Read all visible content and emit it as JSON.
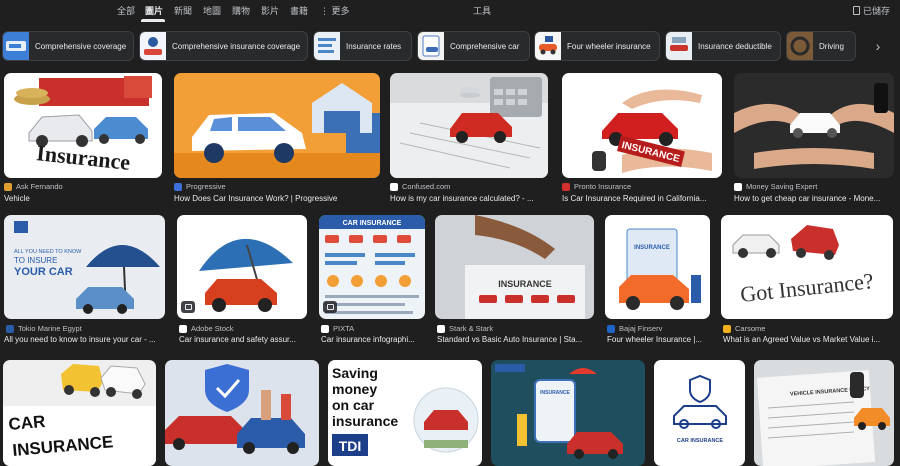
{
  "nav": {
    "tabs": [
      "全部",
      "圖片",
      "新聞",
      "地圖",
      "購物",
      "影片",
      "書籍",
      "更多",
      "工具"
    ],
    "saved": "已儲存"
  },
  "chips": [
    "Comprehensive coverage",
    "Comprehensive insurance coverage",
    "Insurance rates",
    "Comprehensive car",
    "Four wheeler insurance",
    "Insurance deductible",
    "Driving"
  ],
  "results": [
    {
      "source": "Ask Fernando",
      "title": "Vehicle",
      "image_text": "Insurance"
    },
    {
      "source": "Progressive",
      "title": "How Does Car Insurance Work? | Progressive"
    },
    {
      "source": "Confused.com",
      "title": "How is my car insurance calculated? - ..."
    },
    {
      "source": "Pronto Insurance",
      "title": "Is Car Insurance Required in California...",
      "image_text": "INSURANCE"
    },
    {
      "source": "Money Saving Expert",
      "title": "How to get cheap car insurance - Mone..."
    },
    {
      "source": "Tokio Marine Egypt",
      "title": "All you need to know to insure your car - ...",
      "image_text": [
        "ALL YOU NEED TO KNOW",
        "TO INSURE",
        "YOUR CAR"
      ]
    },
    {
      "source": "Adobe Stock",
      "title": "Car insurance and safety assur..."
    },
    {
      "source": "PIXTA",
      "title": "Car insurance infographi...",
      "image_text": "CAR INSURANCE"
    },
    {
      "source": "Stark & Stark",
      "title": "Standard vs Basic Auto Insurance | Sta...",
      "image_text": "INSURANCE"
    },
    {
      "source": "Bajaj Finserv",
      "title": "Four wheeler Insurance |...",
      "image_text": "INSURANCE"
    },
    {
      "source": "Carsome",
      "title": "What is an Agreed Value vs Market Value i...",
      "image_text": "Got Insurance?"
    },
    {
      "image_text": [
        "CAR",
        "INSURANCE"
      ]
    },
    {},
    {
      "image_text": [
        "Saving",
        "money",
        "on car",
        "insurance",
        "TDI"
      ]
    },
    {
      "image_text": "INSURANCE"
    },
    {
      "image_text": "CAR INSURANCE"
    },
    {
      "image_text": "VEHICLE INSURANCE POLICY"
    }
  ],
  "colors": {
    "background": "#1f1f1f",
    "chip_bg": "#282a2c",
    "text": "#e8eaed",
    "muted": "#bdc1c6"
  },
  "icons": {
    "more": "more-dots-icon",
    "saved": "bookmark-icon",
    "next": "chevron-right-icon"
  }
}
